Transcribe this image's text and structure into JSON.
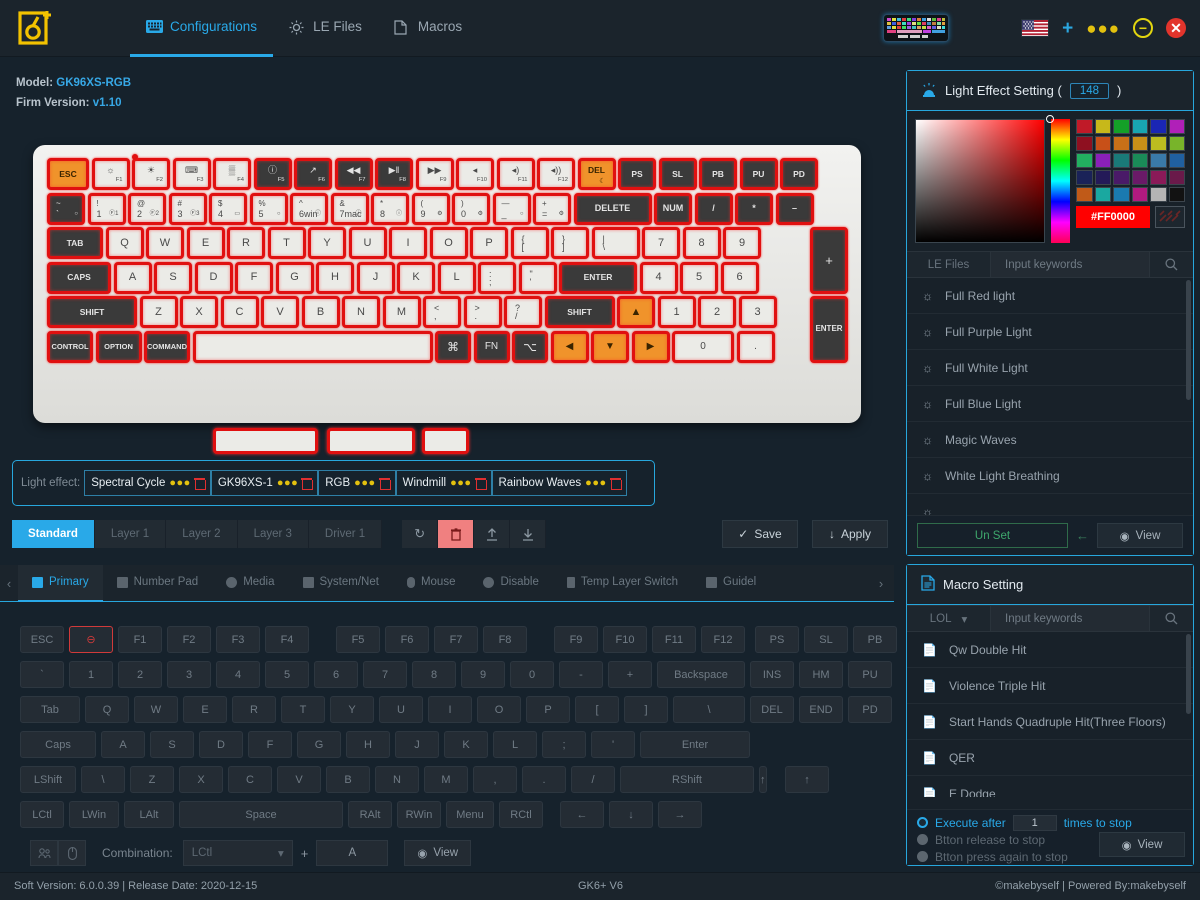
{
  "app": {
    "logo_alt": "GK6+ logo",
    "nav": [
      {
        "label": "Configurations",
        "icon": "keyboard-icon",
        "active": true
      },
      {
        "label": "LE Files",
        "icon": "light-icon",
        "active": false
      },
      {
        "label": "Macros",
        "icon": "document-icon",
        "active": false
      }
    ],
    "window_controls": {
      "more": "●●●",
      "minimize": "−",
      "close": "✕"
    },
    "flag": "us-flag",
    "add": "+"
  },
  "device": {
    "model_label": "Model:",
    "model_value": "GK96XS-RGB",
    "firm_label": "Firm Version:",
    "firm_value": "v1.10"
  },
  "keyboard": {
    "row_fn": [
      {
        "id": "esc",
        "main": "ESC",
        "state": "orange",
        "w": 42
      },
      {
        "id": "f1",
        "sym": "☼",
        "lbl": "F1",
        "state": "light"
      },
      {
        "id": "f2",
        "sym": "☀",
        "lbl": "F2",
        "state": "light"
      },
      {
        "id": "f3",
        "sym": "⌨",
        "lbl": "F3",
        "state": "light"
      },
      {
        "id": "f4",
        "sym": "▒",
        "lbl": "F4",
        "state": "light"
      },
      {
        "id": "f5",
        "sym": "ⓘ",
        "lbl": "F5",
        "state": "dark"
      },
      {
        "id": "f6",
        "sym": "↗",
        "lbl": "F6",
        "state": "dark"
      },
      {
        "id": "f7",
        "sym": "◀◀",
        "lbl": "F7",
        "state": "dark"
      },
      {
        "id": "f8",
        "sym": "▶‖",
        "lbl": "F8",
        "state": "dark"
      },
      {
        "id": "f9",
        "sym": "▶▶",
        "lbl": "F9",
        "state": "light"
      },
      {
        "id": "f10",
        "sym": "◂",
        "lbl": "F10",
        "state": "light"
      },
      {
        "id": "f11",
        "sym": "◂)",
        "lbl": "F11",
        "state": "light"
      },
      {
        "id": "f12",
        "sym": "◂))",
        "lbl": "F12",
        "state": "light"
      },
      {
        "id": "del",
        "main": "DEL",
        "sub": "☾",
        "state": "orange"
      },
      {
        "id": "ps",
        "main": "PS",
        "state": "dark"
      },
      {
        "id": "sl",
        "main": "SL",
        "state": "dark"
      },
      {
        "id": "pb",
        "main": "PB",
        "state": "dark"
      },
      {
        "id": "pu",
        "main": "PU",
        "state": "dark"
      },
      {
        "id": "pd",
        "main": "PD",
        "state": "dark"
      }
    ],
    "row_num": [
      {
        "top": "~",
        "bot": "`",
        "state": "dark",
        "cor": "○"
      },
      {
        "top": "!",
        "bot": "1",
        "cor": "Ⓕ1"
      },
      {
        "top": "@",
        "bot": "2",
        "cor": "Ⓕ2"
      },
      {
        "top": "#",
        "bot": "3",
        "cor": "Ⓕ3"
      },
      {
        "top": "$",
        "bot": "4",
        "cor": "▭"
      },
      {
        "top": "%",
        "bot": "5",
        "cor": "○"
      },
      {
        "top": "^",
        "bot": "6win",
        "cor": "ⓘ"
      },
      {
        "top": "&",
        "bot": "7mac",
        "cor": "ⓘ"
      },
      {
        "top": "*",
        "bot": "8",
        "cor": "ⓘ"
      },
      {
        "top": "(",
        "bot": "9",
        "cor": "⚙"
      },
      {
        "top": ")",
        "bot": "0",
        "cor": "⚙"
      },
      {
        "top": "—",
        "bot": "_",
        "cor": "○"
      },
      {
        "top": "+",
        "bot": "=",
        "cor": "⚙"
      },
      {
        "main": "DELETE",
        "state": "dark",
        "w": 78
      },
      {
        "main": "NUM",
        "state": "dark"
      },
      {
        "main": "/",
        "state": "dark"
      },
      {
        "main": "*",
        "state": "dark"
      },
      {
        "main": "–",
        "state": "dark"
      }
    ],
    "row_q": [
      "TAB",
      "Q",
      "W",
      "E",
      "R",
      "T",
      "Y",
      "U",
      "I",
      "O",
      "P",
      "{ [",
      "} ]",
      "| \\",
      "7",
      "8",
      "9"
    ],
    "row_a": [
      "CAPS",
      "A",
      "S",
      "D",
      "F",
      "G",
      "H",
      "J",
      "K",
      "L",
      ": ;",
      "\" '",
      "ENTER",
      "4",
      "5",
      "6"
    ],
    "row_z": [
      "SHIFT",
      "Z",
      "X",
      "C",
      "V",
      "B",
      "N",
      "M",
      "< ,",
      "> .",
      "? /",
      "SHIFT",
      "▲",
      "1",
      "2",
      "3"
    ],
    "row_b": [
      "CONTROL",
      "OPTION",
      "COMMAND",
      "",
      "⌘",
      "FN",
      "⌥",
      "◀",
      "▼",
      "▶",
      "0",
      "."
    ],
    "numpad_plus": "+",
    "numpad_enter": "ENTER"
  },
  "light_effect_bar": {
    "label": "Light effect:",
    "chips": [
      {
        "name": "Spectral Cycle"
      },
      {
        "name": "GK96XS-1"
      },
      {
        "name": "RGB"
      },
      {
        "name": "Windmill"
      },
      {
        "name": "Rainbow Waves"
      }
    ],
    "dots": "●●●"
  },
  "layers": {
    "tabs": [
      {
        "label": "Standard",
        "active": true
      },
      {
        "label": "Layer 1",
        "active": false
      },
      {
        "label": "Layer 2",
        "active": false
      },
      {
        "label": "Layer 3",
        "active": false
      },
      {
        "label": "Driver 1",
        "active": false
      }
    ],
    "tools": [
      {
        "name": "refresh-icon",
        "glyph": "↻",
        "style": "normal"
      },
      {
        "name": "delete-icon",
        "glyph": "Ὕ1",
        "style": "red"
      },
      {
        "name": "upload-icon",
        "glyph": "↑",
        "style": "normal"
      },
      {
        "name": "download-icon",
        "glyph": "↓",
        "style": "normal"
      }
    ],
    "save": "Save",
    "apply": "Apply",
    "save_icon": "✓",
    "apply_icon": "↓"
  },
  "assign_tabs": [
    {
      "label": "Primary",
      "icon": "keyboard-icon",
      "active": true
    },
    {
      "label": "Number Pad",
      "icon": "numpad-icon",
      "active": false
    },
    {
      "label": "Media",
      "icon": "media-icon",
      "active": false
    },
    {
      "label": "System/Net",
      "icon": "monitor-icon",
      "active": false
    },
    {
      "label": "Mouse",
      "icon": "mouse-icon",
      "active": false
    },
    {
      "label": "Disable",
      "icon": "disable-icon",
      "active": false
    },
    {
      "label": "Temp Layer Switch",
      "icon": "layer-icon",
      "active": false
    },
    {
      "label": "Guidel",
      "icon": "guide-icon",
      "active": false
    }
  ],
  "virtual_keys": {
    "row1": [
      "ESC",
      "⊖",
      "F1",
      "F2",
      "F3",
      "F4",
      "F5",
      "F6",
      "F7",
      "F8",
      "F9",
      "F10",
      "F11",
      "F12",
      "PS",
      "SL",
      "PB"
    ],
    "row2": [
      "`",
      "1",
      "2",
      "3",
      "4",
      "5",
      "6",
      "7",
      "8",
      "9",
      "0",
      "-",
      "+",
      "Backspace",
      "INS",
      "HM",
      "PU"
    ],
    "row3": [
      "Tab",
      "Q",
      "W",
      "E",
      "R",
      "T",
      "Y",
      "U",
      "I",
      "O",
      "P",
      "[",
      "]",
      "\\",
      "DEL",
      "END",
      "PD"
    ],
    "row4": [
      "Caps",
      "A",
      "S",
      "D",
      "F",
      "G",
      "H",
      "J",
      "K",
      "L",
      ";",
      "'",
      "Enter"
    ],
    "row5": [
      "LShift",
      "\\",
      "Z",
      "X",
      "C",
      "V",
      "B",
      "N",
      "M",
      ",",
      ".",
      "/",
      "RShift",
      "↑"
    ],
    "row6": [
      "LCtl",
      "LWin",
      "LAlt",
      "Space",
      "RAlt",
      "RWin",
      "Menu",
      "RCtl",
      "←",
      "↓",
      "→"
    ],
    "selected": "⊖"
  },
  "combination": {
    "label": "Combination:",
    "modifier": "LCtl",
    "plus": "+",
    "key": "A",
    "view": "View",
    "view_icon": "eye-icon",
    "tool_icons": [
      "users-icon",
      "mouse-icon"
    ]
  },
  "light_panel": {
    "title": "Light Effect Setting (",
    "title_end": ")",
    "count": "148",
    "title_icon": "lamp-icon",
    "hex": "#FF0000",
    "hex_color": "#FF0000",
    "eyedropper": "eyedropper-icon",
    "swatches": [
      "#c01a28",
      "#c7b81a",
      "#14a028",
      "#18a6b0",
      "#1a26b4",
      "#b020b8",
      "#8e1020",
      "#c85018",
      "#c87018",
      "#c89018",
      "#bcbc20",
      "#78b42a",
      "#22b060",
      "#8a20b8",
      "#1a7a78",
      "#1a8a58",
      "#3a7aa8",
      "#2060a0",
      "#1a2258",
      "#241a58",
      "#4a1a68",
      "#6a1a68",
      "#8a1a58",
      "#6a1a4a",
      "#c05a18",
      "#1aa8a0",
      "#1a7ab0",
      "#b01a80",
      "#b4b4b4",
      "#121212"
    ],
    "search": {
      "tag": "LE Files",
      "placeholder": "Input keywords",
      "icon": "search-icon"
    },
    "items": [
      {
        "label": "Full Red light"
      },
      {
        "label": "Full Purple Light"
      },
      {
        "label": "Full White Light"
      },
      {
        "label": "Full Blue Light"
      },
      {
        "label": "Magic Waves"
      },
      {
        "label": "White Light Breathing"
      }
    ],
    "unset": "Un Set",
    "view": "View"
  },
  "macro_panel": {
    "title": "Macro Setting",
    "title_icon": "document-icon",
    "search": {
      "tag": "LOL",
      "placeholder": "Input keywords",
      "icon": "search-icon"
    },
    "items": [
      {
        "label": "Qw Double Hit"
      },
      {
        "label": "Violence Triple Hit"
      },
      {
        "label": "Start Hands Quadruple Hit(Three Floors)"
      },
      {
        "label": "QER"
      },
      {
        "label": "E Dodge"
      }
    ],
    "options": [
      {
        "pre": "Execute after",
        "count": "1",
        "post": "times to stop",
        "selected": true
      },
      {
        "pre": "Btton release to stop",
        "selected": false
      },
      {
        "pre": "Btton press again to stop",
        "selected": false
      }
    ],
    "view": "View"
  },
  "footer": {
    "left": "Soft Version: 6.0.0.39 |  Release Date: 2020-12-15",
    "center": "GK6+ V6",
    "right": "©makebyself |  Powered By:makebyself"
  }
}
